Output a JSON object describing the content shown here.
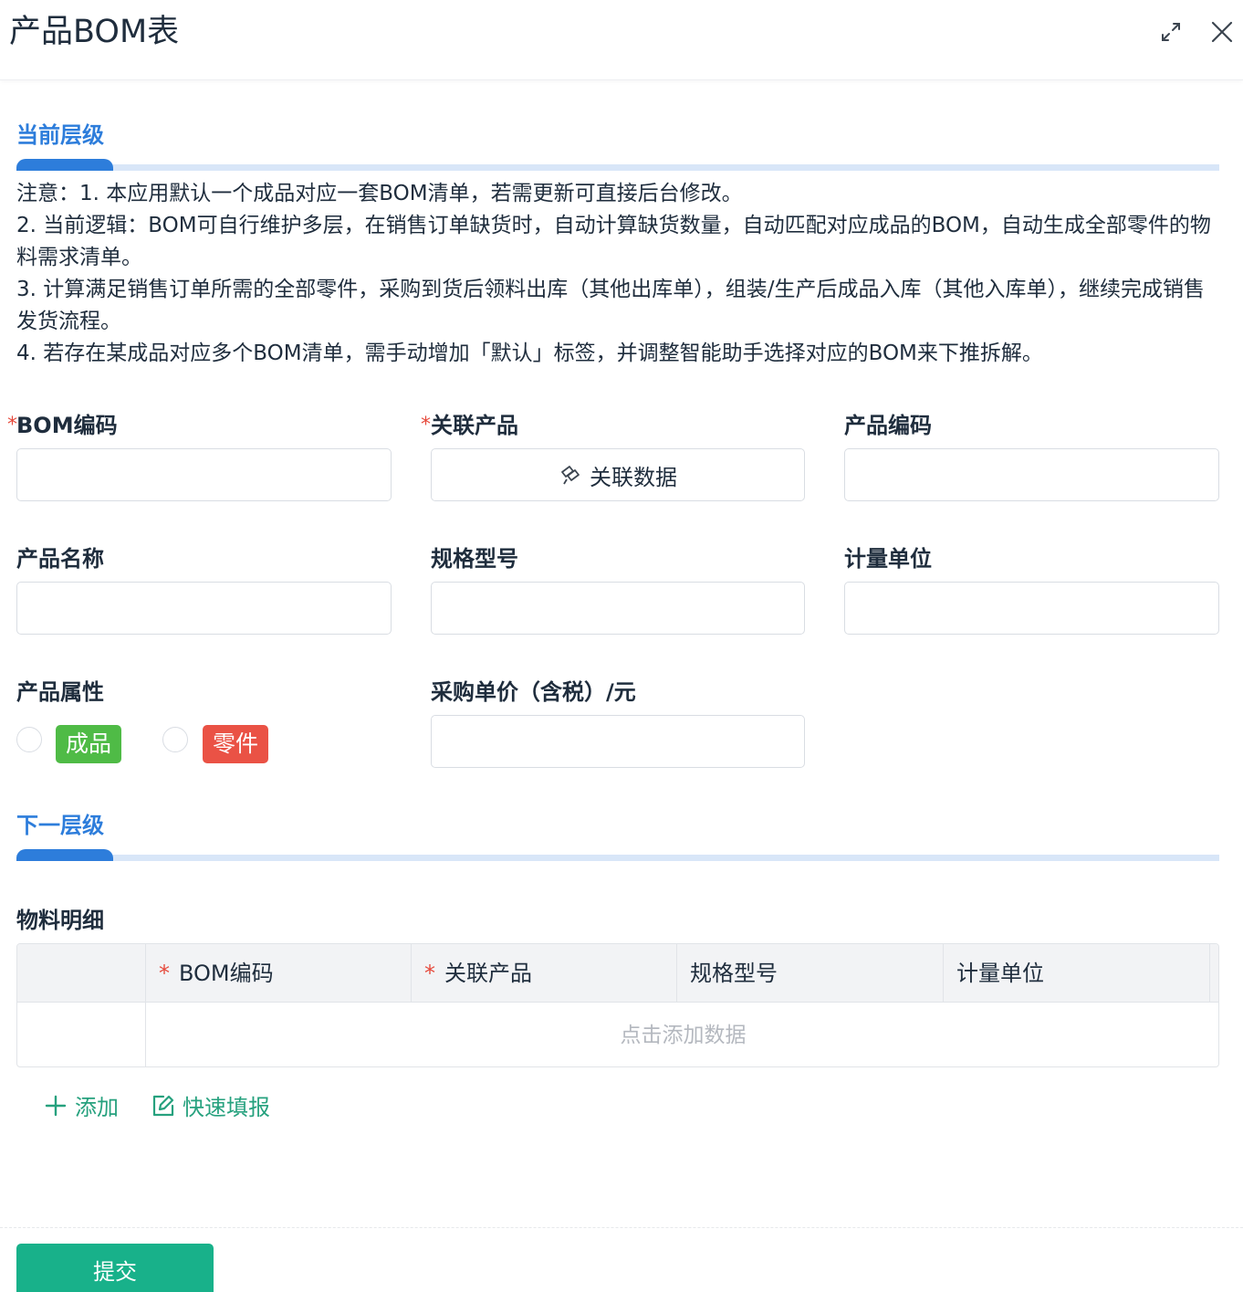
{
  "dialog": {
    "title": "产品BOM表"
  },
  "section_current": {
    "title": "当前层级",
    "notes": [
      "注意：1. 本应用默认一个成品对应一套BOM清单，若需更新可直接后台修改。",
      "2. 当前逻辑：BOM可自行维护多层，在销售订单缺货时，自动计算缺货数量，自动匹配对应成品的BOM，自动生成全部零件的物料需求清单。",
      "3. 计算满足销售订单所需的全部零件，采购到货后领料出库（其他出库单），组装/生产后成品入库（其他入库单），继续完成销售发货流程。",
      "4. 若存在某成品对应多个BOM清单，需手动增加「默认」标签，并调整智能助手选择对应的BOM来下推拆解。"
    ]
  },
  "form": {
    "required_mark": "*",
    "bom_code": {
      "label": "BOM编码",
      "value": ""
    },
    "linked_product": {
      "label": "关联产品",
      "button_label": "关联数据"
    },
    "product_code": {
      "label": "产品编码",
      "value": ""
    },
    "product_name": {
      "label": "产品名称",
      "value": ""
    },
    "spec_model": {
      "label": "规格型号",
      "value": ""
    },
    "unit": {
      "label": "计量单位",
      "value": ""
    },
    "product_attr": {
      "label": "产品属性",
      "options": [
        {
          "label": "成品",
          "color": "#4fbb46"
        },
        {
          "label": "零件",
          "color": "#ea5245"
        }
      ]
    },
    "purchase_price": {
      "label": "采购单价（含税）/元",
      "value": ""
    }
  },
  "section_next": {
    "title": "下一层级"
  },
  "material_detail": {
    "label": "物料明细",
    "columns": [
      {
        "label": "BOM编码",
        "required": true
      },
      {
        "label": "关联产品",
        "required": true
      },
      {
        "label": "规格型号",
        "required": false
      },
      {
        "label": "计量单位",
        "required": false
      }
    ],
    "empty_text": "点击添加数据",
    "add_label": "添加",
    "quick_fill_label": "快速填报"
  },
  "footer": {
    "submit_label": "提交"
  },
  "colors": {
    "accent_blue": "#2d7ddb",
    "required_red": "#e64a3c",
    "action_green": "#26a17e",
    "submit_green": "#18b18a"
  }
}
